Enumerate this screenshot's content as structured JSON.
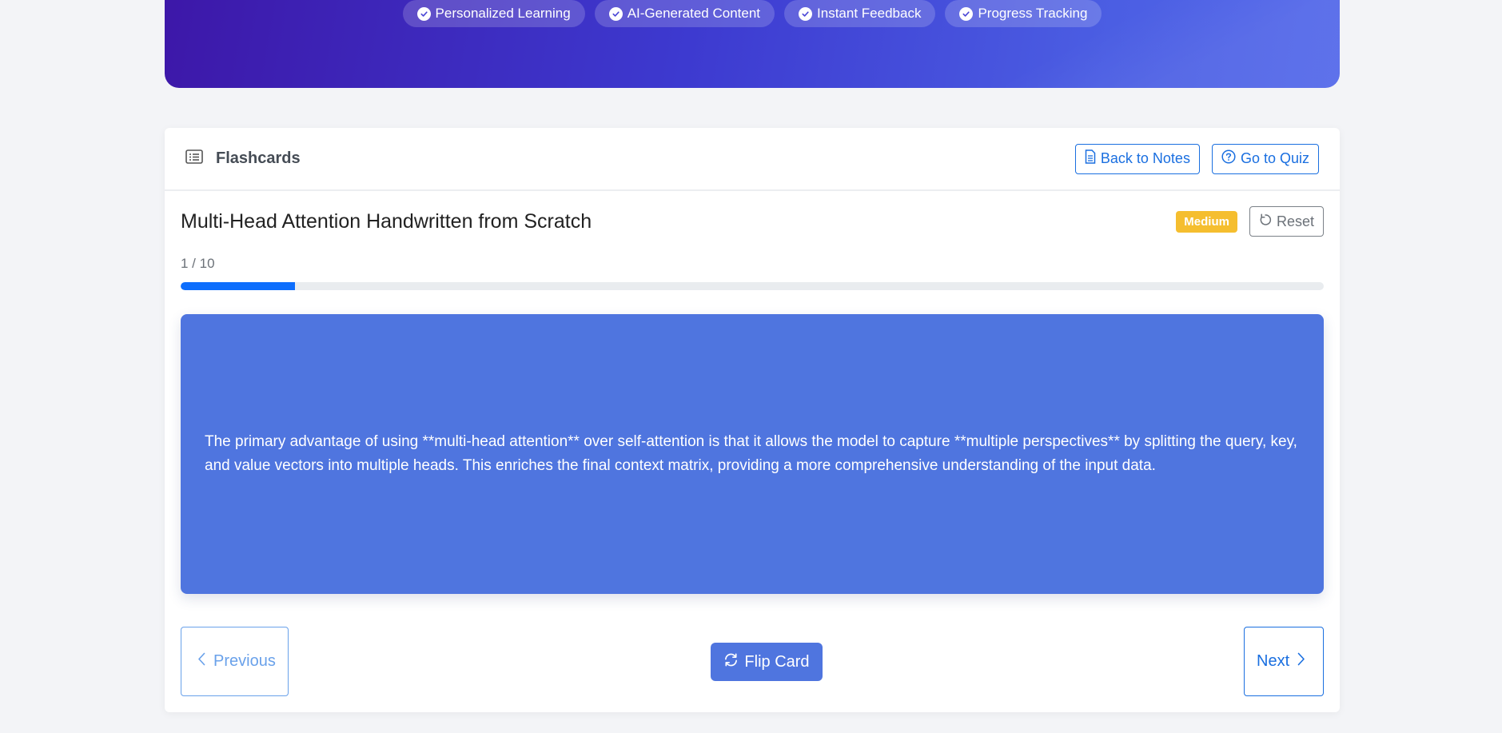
{
  "hero": {
    "features": [
      {
        "label": "Personalized Learning",
        "icon": "check-circle-icon"
      },
      {
        "label": "AI-Generated Content",
        "icon": "check-circle-icon"
      },
      {
        "label": "Instant Feedback",
        "icon": "check-circle-icon"
      },
      {
        "label": "Progress Tracking",
        "icon": "check-circle-icon"
      }
    ]
  },
  "header": {
    "title": "Flashcards",
    "title_icon": "card-list-icon",
    "back_to_notes": "Back to Notes",
    "go_to_quiz": "Go to Quiz"
  },
  "deck": {
    "title": "Multi-Head Attention Handwritten from Scratch",
    "difficulty": "Medium",
    "reset_label": "Reset",
    "counter": "1 / 10",
    "progress_fraction": 0.1
  },
  "card": {
    "text": "The primary advantage of using **multi-head attention** over self-attention is that it allows the model to capture **multiple perspectives** by splitting the query, key, and value vectors into multiple heads. This enriches the final context matrix, providing a more comprehensive understanding of the input data."
  },
  "controls": {
    "previous": "Previous",
    "flip": "Flip Card",
    "next": "Next"
  },
  "colors": {
    "primary": "#1a6fe0",
    "card_bg": "#4f75df",
    "badge": "#f5be2f",
    "progress": "#0d6efd"
  }
}
